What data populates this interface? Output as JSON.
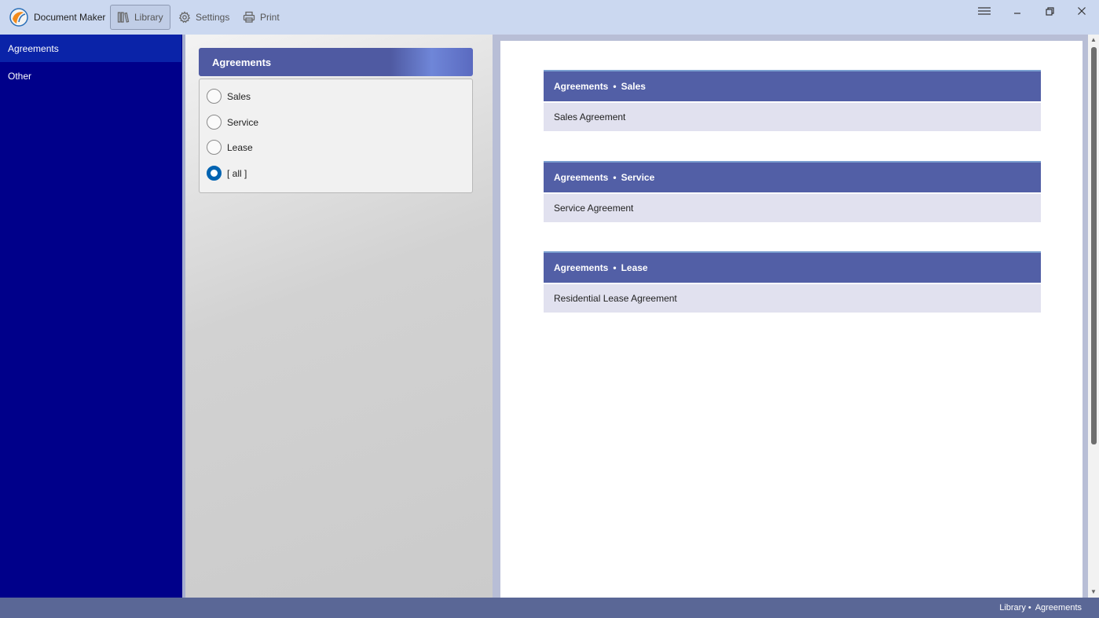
{
  "titlebar": {
    "app_name": "Document Maker",
    "buttons": [
      {
        "label": "Library",
        "icon": "library-icon",
        "active": true
      },
      {
        "label": "Settings",
        "icon": "gear-icon",
        "active": false
      },
      {
        "label": "Print",
        "icon": "printer-icon",
        "active": false
      }
    ],
    "window_controls": [
      "menu-icon",
      "minimize-icon",
      "restore-icon",
      "close-icon"
    ]
  },
  "nav": {
    "items": [
      {
        "label": "Agreements",
        "selected": true
      },
      {
        "label": "Other",
        "selected": false
      }
    ]
  },
  "filter": {
    "header": "Agreements",
    "options": [
      {
        "label": "Sales",
        "checked": false
      },
      {
        "label": "Service",
        "checked": false
      },
      {
        "label": "Lease",
        "checked": false
      },
      {
        "label": "[ all ]",
        "checked": true
      }
    ]
  },
  "documents": [
    {
      "category": "Agreements",
      "subcategory": "Sales",
      "title": "Sales Agreement"
    },
    {
      "category": "Agreements",
      "subcategory": "Service",
      "title": "Service Agreement"
    },
    {
      "category": "Agreements",
      "subcategory": "Lease",
      "title": "Residential Lease Agreement"
    }
  ],
  "statusbar": {
    "path": [
      "Library",
      "Agreements"
    ],
    "separator": "•"
  },
  "colors": {
    "titlebar": "#cbd8f0",
    "nav_bg": "#00008a",
    "nav_selected": "#0a23a8",
    "card_header": "#525fa6",
    "card_body": "#e1e1ef",
    "statusbar": "#5a6796",
    "radio_accent": "#0063b1"
  }
}
